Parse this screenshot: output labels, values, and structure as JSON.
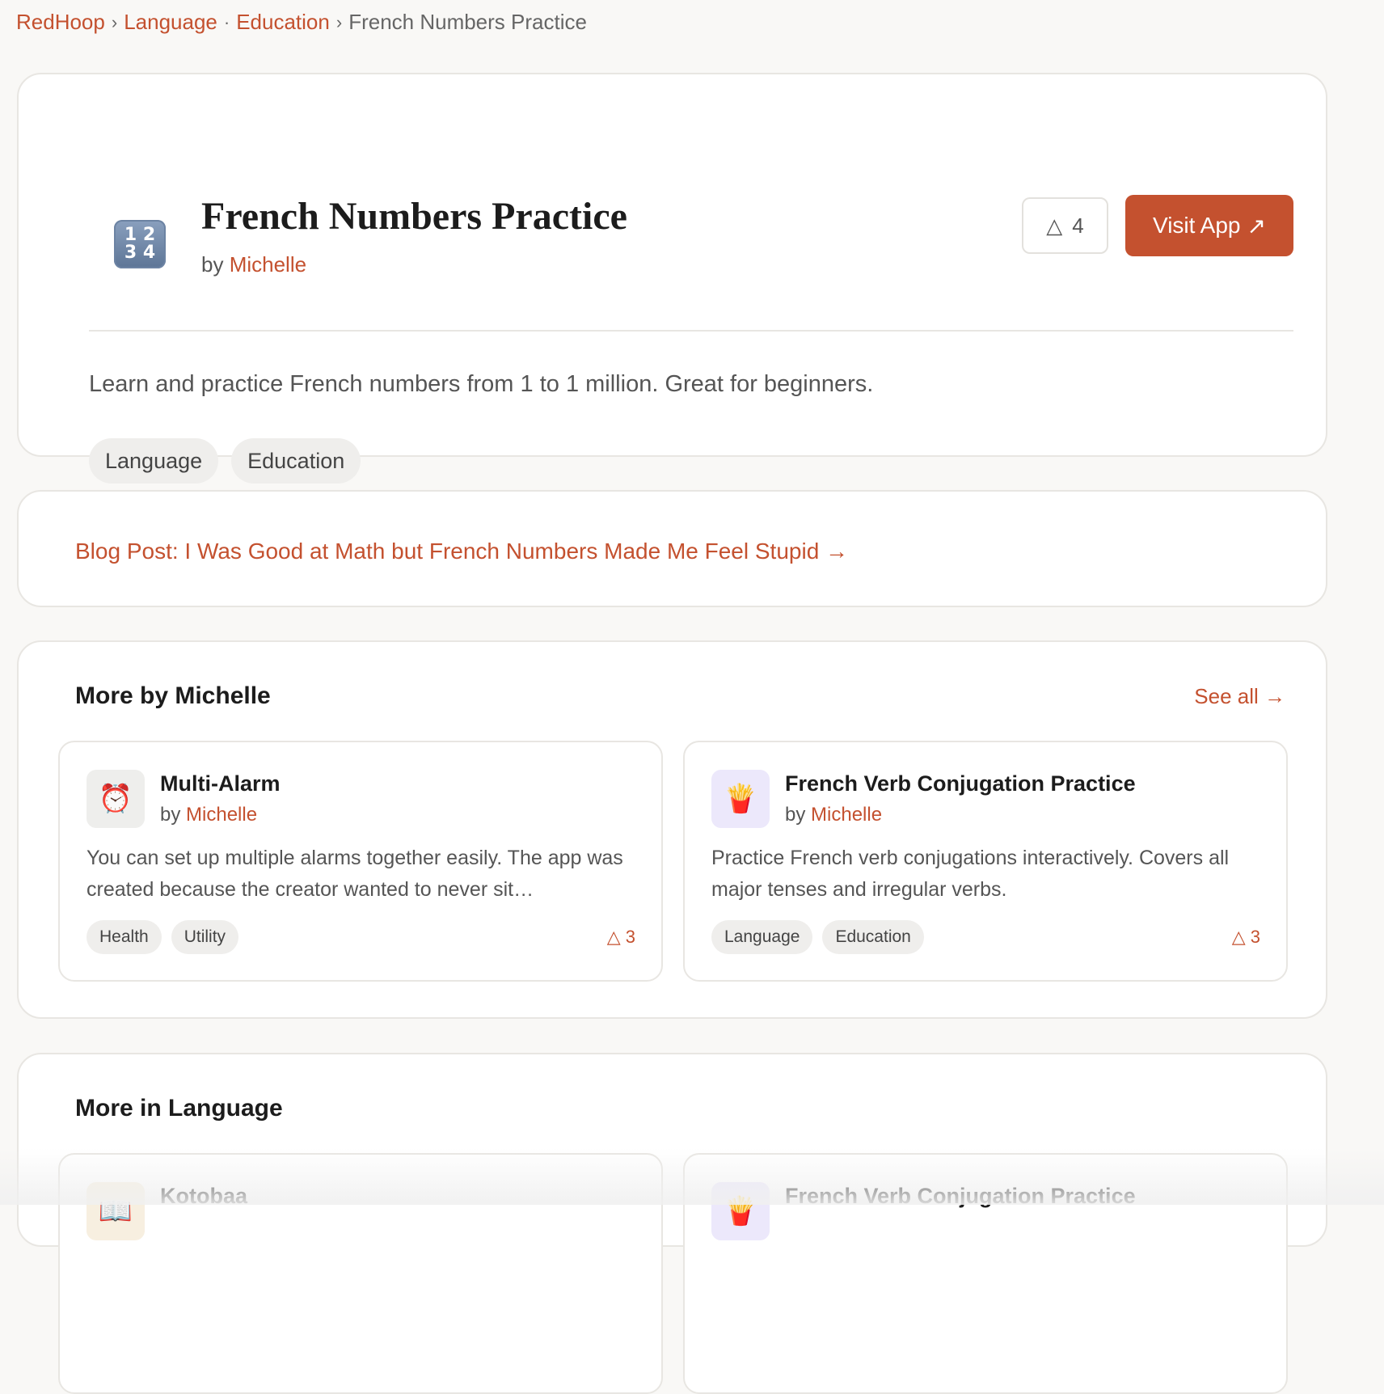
{
  "breadcrumb": {
    "home": "RedHoop",
    "cat1": "Language",
    "cat2": "Education",
    "current": "French Numbers Practice"
  },
  "app": {
    "icon_text_top": "1 2",
    "icon_text_bottom": "3 4",
    "title": "French Numbers Practice",
    "by_label": "by",
    "author": "Michelle",
    "upvotes": "4",
    "visit_label": "Visit App",
    "description": "Learn and practice French numbers from 1 to 1 million. Great for beginners.",
    "tags": [
      "Language",
      "Education"
    ]
  },
  "blog": {
    "link_text": "Blog Post: I Was Good at Math but French Numbers Made Me Feel Stupid →"
  },
  "more_by": {
    "title": "More by Michelle",
    "see_all": "See all →",
    "apps": [
      {
        "icon": "⏰",
        "icon_bg": "#eeeeec",
        "name": "Multi-Alarm",
        "by_label": "by",
        "author": "Michelle",
        "description": "You can set up multiple alarms together easily. The app was created because the creator wanted to never sit…",
        "tags": [
          "Health",
          "Utility"
        ],
        "votes": "3"
      },
      {
        "icon": "🍟",
        "icon_bg": "#ece8fb",
        "name": "French Verb Conjugation Practice",
        "by_label": "by",
        "author": "Michelle",
        "description": "Practice French verb conjugations interactively. Covers all major tenses and irregular verbs.",
        "tags": [
          "Language",
          "Education"
        ],
        "votes": "3"
      }
    ]
  },
  "more_in": {
    "title": "More in Language",
    "apps": [
      {
        "icon": "📖",
        "icon_bg": "#f7efe0",
        "name": "Kotobaa"
      },
      {
        "icon": "🍟",
        "icon_bg": "#ece8fb",
        "name": "French Verb Conjugation Practice"
      }
    ]
  },
  "colors": {
    "accent": "#c4512f",
    "background": "#f9f8f6"
  }
}
